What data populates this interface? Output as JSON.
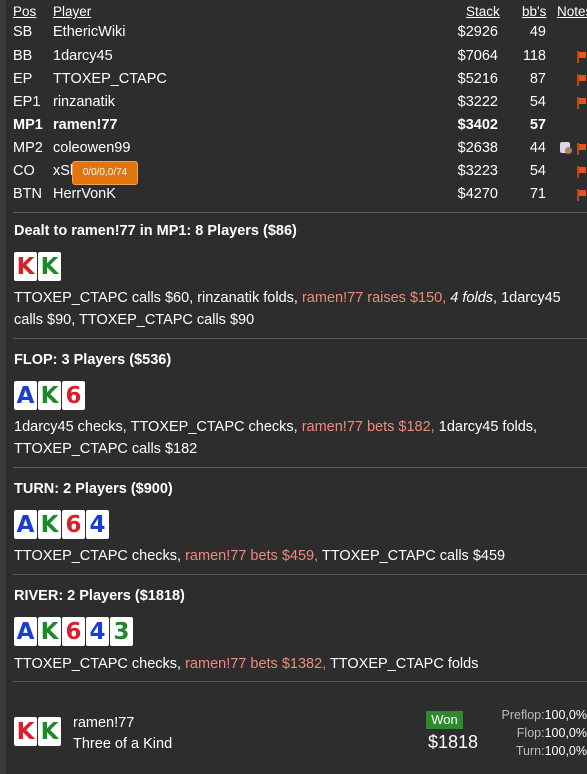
{
  "table": {
    "headers": {
      "pos": "Pos",
      "player": "Player",
      "stack": "Stack",
      "bbs": "bb's",
      "notes": "Notes"
    },
    "rows": [
      {
        "pos": "SB",
        "name": "EthericWiki",
        "stack": "$2926",
        "bbs": "49",
        "hero": false
      },
      {
        "pos": "BB",
        "name": "1darcy45",
        "stack": "$7064",
        "bbs": "118",
        "hero": false
      },
      {
        "pos": "EP",
        "name": "TTOXEP_CTAPC",
        "stack": "$5216",
        "bbs": "87",
        "hero": false
      },
      {
        "pos": "EP1",
        "name": "rinzanatik",
        "stack": "$3222",
        "bbs": "54",
        "hero": false
      },
      {
        "pos": "MP1",
        "name": "ramen!77",
        "stack": "$3402",
        "bbs": "57",
        "hero": true
      },
      {
        "pos": "MP2",
        "name": "coleowen99",
        "stack": "$2638",
        "bbs": "44",
        "hero": false
      },
      {
        "pos": "CO",
        "name": "xSl",
        "stack": "$3223",
        "bbs": "54",
        "hero": false
      },
      {
        "pos": "BTN",
        "name": "HerrVonK",
        "stack": "$4270",
        "bbs": "71",
        "hero": false
      }
    ],
    "tooltip": "0/0/0,0/74"
  },
  "preflop": {
    "title": "Dealt to ramen!77 in MP1: 8 Players ($86)",
    "cards": [
      {
        "rank": "K",
        "suit": "h"
      },
      {
        "rank": "K",
        "suit": "c"
      }
    ],
    "parts": {
      "a": "TTOXEP_CTAPC calls $60, rinzanatik folds, ",
      "hero": "ramen!77 raises $150, ",
      "ital": "4 folds",
      "b": ", 1darcy45 calls $90, TTOXEP_CTAPC calls $90"
    }
  },
  "flop": {
    "title": "FLOP: 3 Players ($536)",
    "cards": [
      {
        "rank": "A",
        "suit": "d"
      },
      {
        "rank": "K",
        "suit": "c"
      },
      {
        "rank": "6",
        "suit": "h"
      }
    ],
    "parts": {
      "a": "1darcy45 checks, TTOXEP_CTAPC checks, ",
      "hero": "ramen!77 bets $182, ",
      "b": "1darcy45 folds, TTOXEP_CTAPC calls $182"
    }
  },
  "turn": {
    "title": "TURN: 2 Players ($900)",
    "cards": [
      {
        "rank": "A",
        "suit": "d"
      },
      {
        "rank": "K",
        "suit": "c"
      },
      {
        "rank": "6",
        "suit": "h"
      },
      {
        "rank": "4",
        "suit": "d"
      }
    ],
    "parts": {
      "a": "TTOXEP_CTAPC checks, ",
      "hero": "ramen!77 bets $459, ",
      "b": "TTOXEP_CTAPC calls $459"
    }
  },
  "river": {
    "title": "RIVER: 2 Players ($1818)",
    "cards": [
      {
        "rank": "A",
        "suit": "d"
      },
      {
        "rank": "K",
        "suit": "c"
      },
      {
        "rank": "6",
        "suit": "h"
      },
      {
        "rank": "4",
        "suit": "d"
      },
      {
        "rank": "3",
        "suit": "c"
      }
    ],
    "parts": {
      "a": "TTOXEP_CTAPC checks, ",
      "hero": "ramen!77 bets $1382, ",
      "b": "TTOXEP_CTAPC folds"
    }
  },
  "result": {
    "cards": [
      {
        "rank": "K",
        "suit": "h"
      },
      {
        "rank": "K",
        "suit": "c"
      }
    ],
    "player": "ramen!77",
    "hand": "Three of a Kind",
    "won_label": "Won",
    "amount": "$1818",
    "equity": [
      {
        "label": "Preflop:",
        "value": "100,0%"
      },
      {
        "label": "Flop:",
        "value": "100,0%"
      },
      {
        "label": "Turn:",
        "value": "100,0%"
      }
    ]
  },
  "colors": {
    "background": "#2d2d2d",
    "hero_action": "#f08a7a",
    "won_badge": "#2e8a2e",
    "tooltip": "#e07410"
  }
}
